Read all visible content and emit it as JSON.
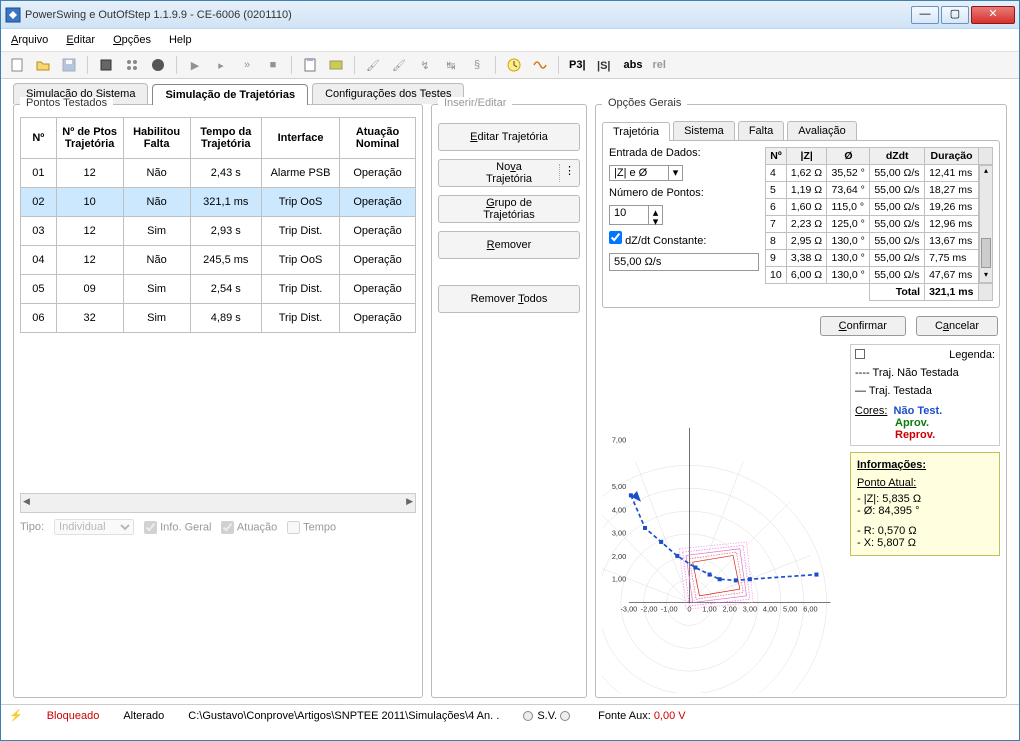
{
  "title": "PowerSwing e OutOfStep 1.1.9.9 - CE-6006 (0201110)",
  "menu": {
    "arquivo": "Arquivo",
    "editar": "Editar",
    "opcoes": "Opções",
    "help": "Help"
  },
  "main_tabs": {
    "sim_sistema": "Simulação do Sistema",
    "sim_traj": "Simulação de Trajetórias",
    "config_testes": "Configurações dos Testes"
  },
  "left_panel_title": "Pontos Testados",
  "left_headers": {
    "no": "Nº",
    "ptos": "Nº de Ptos Trajetória",
    "hab": "Habilitou Falta",
    "tempo": "Tempo da Trajetória",
    "interface": "Interface",
    "atuacao": "Atuação Nominal"
  },
  "left_rows": [
    {
      "no": "01",
      "ptos": "12",
      "hab": "Não",
      "tempo": "2,43 s",
      "interface": "Alarme PSB",
      "atuacao": "Operação"
    },
    {
      "no": "02",
      "ptos": "10",
      "hab": "Não",
      "tempo": "321,1 ms",
      "interface": "Trip OoS",
      "atuacao": "Operação"
    },
    {
      "no": "03",
      "ptos": "12",
      "hab": "Sim",
      "tempo": "2,93 s",
      "interface": "Trip Dist.",
      "atuacao": "Operação"
    },
    {
      "no": "04",
      "ptos": "12",
      "hab": "Não",
      "tempo": "245,5 ms",
      "interface": "Trip OoS",
      "atuacao": "Operação"
    },
    {
      "no": "05",
      "ptos": "09",
      "hab": "Sim",
      "tempo": "2,54 s",
      "interface": "Trip Dist.",
      "atuacao": "Operação"
    },
    {
      "no": "06",
      "ptos": "32",
      "hab": "Sim",
      "tempo": "4,89 s",
      "interface": "Trip Dist.",
      "atuacao": "Operação"
    }
  ],
  "tipo": {
    "label": "Tipo:",
    "value": "Individual",
    "info_geral": "Info. Geral",
    "atuacao": "Atuação",
    "tempo": "Tempo"
  },
  "mid_panel_title": "Inserir/Editar",
  "mid_buttons": {
    "editar": "Editar Trajetória",
    "nova": "Nova Trajetória",
    "grupo": "Grupo de Trajetórias",
    "remover": "Remover",
    "remover_todos": "Remover Todos"
  },
  "right_panel_title": "Opções Gerais",
  "subtabs": {
    "traj": "Trajetória",
    "sistema": "Sistema",
    "falta": "Falta",
    "aval": "Avaliação"
  },
  "opts": {
    "entrada_label": "Entrada de Dados:",
    "entrada_value": "|Z| e Ø",
    "numpts_label": "Número de Pontos:",
    "numpts_value": "10",
    "dzdt_label": "dZ/dt Constante:",
    "dzdt_value": "55,00 Ω/s"
  },
  "opts_headers": {
    "no": "Nº",
    "z": "|Z|",
    "ang": "Ø",
    "dzdt": "dZdt",
    "dur": "Duração"
  },
  "opts_rows": [
    {
      "no": "4",
      "z": "1,62 Ω",
      "ang": "35,52 °",
      "dzdt": "55,00 Ω/s",
      "dur": "12,41 ms"
    },
    {
      "no": "5",
      "z": "1,19 Ω",
      "ang": "73,64 °",
      "dzdt": "55,00 Ω/s",
      "dur": "18,27 ms"
    },
    {
      "no": "6",
      "z": "1,60 Ω",
      "ang": "115,0 °",
      "dzdt": "55,00 Ω/s",
      "dur": "19,26 ms"
    },
    {
      "no": "7",
      "z": "2,23 Ω",
      "ang": "125,0 °",
      "dzdt": "55,00 Ω/s",
      "dur": "12,96 ms"
    },
    {
      "no": "8",
      "z": "2,95 Ω",
      "ang": "130,0 °",
      "dzdt": "55,00 Ω/s",
      "dur": "13,67 ms"
    },
    {
      "no": "9",
      "z": "3,38 Ω",
      "ang": "130,0 °",
      "dzdt": "55,00 Ω/s",
      "dur": "7,75 ms"
    },
    {
      "no": "10",
      "z": "6,00 Ω",
      "ang": "130,0 °",
      "dzdt": "55,00 Ω/s",
      "dur": "47,67 ms"
    }
  ],
  "opts_total": {
    "label": "Total",
    "value": "321,1 ms"
  },
  "btns": {
    "confirmar": "Confirmar",
    "cancelar": "Cancelar"
  },
  "legend": {
    "title": "Legenda:",
    "nao_testada": "Traj. Não Testada",
    "testada": "Traj. Testada",
    "cores_label": "Cores:",
    "nao_test": "Não Test.",
    "aprov": "Aprov.",
    "reprov": "Reprov."
  },
  "info": {
    "title": "Informações:",
    "ponto_atual": "Ponto Atual:",
    "z": "- |Z|: 5,835 Ω",
    "ang": "- Ø: 84,395 °",
    "r": "- R: 0,570 Ω",
    "x": "- X: 5,807 Ω"
  },
  "status": {
    "bloqueado": "Bloqueado",
    "alterado": "Alterado",
    "path": "C:\\Gustavo\\Conprove\\Artigos\\SNPTEE 2011\\Simulações\\4 An. .",
    "sv": "S.V.",
    "fonte_label": "Fonte Aux:",
    "fonte_value": "0,00 V"
  },
  "chart_data": {
    "type": "line",
    "title": "",
    "xlim": [
      -3,
      7
    ],
    "ylim": [
      0,
      7.5
    ],
    "xticks": [
      "-3,00",
      "-2,00",
      "-1,00",
      "0",
      "1,00",
      "2,00",
      "3,00",
      "4,00",
      "5,00",
      "6,00"
    ],
    "yticks": [
      "1,00",
      "2,00",
      "3,00",
      "4,00",
      "5,00",
      "7,00"
    ],
    "series": [
      {
        "name": "Trajetória",
        "x": [
          -2.9,
          -2.2,
          -1.4,
          -0.6,
          0.3,
          1.0,
          1.5,
          2.3,
          3.0,
          6.3
        ],
        "y": [
          4.6,
          3.2,
          2.6,
          2.0,
          1.5,
          1.2,
          1.0,
          0.95,
          1.0,
          1.2
        ]
      }
    ]
  }
}
